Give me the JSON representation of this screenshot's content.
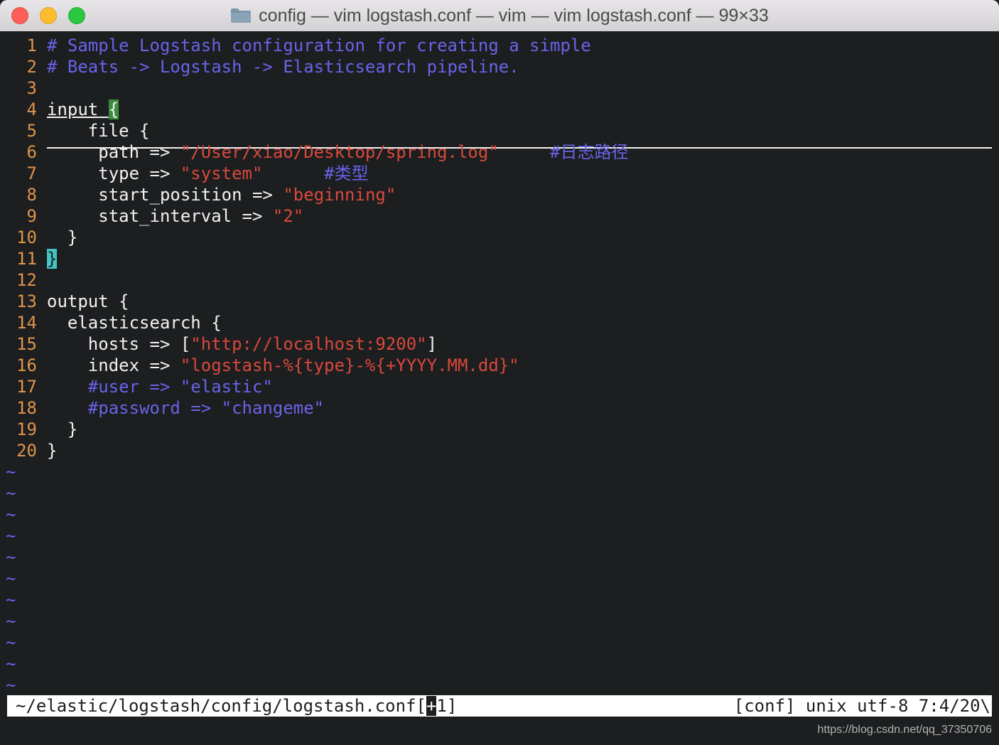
{
  "window": {
    "title": "config — vim logstash.conf — vim — vim logstash.conf — 99×33",
    "close_glyph": "×"
  },
  "colors": {
    "line_number": "#e0944a",
    "comment": "#6a63e8",
    "string": "#d9493c",
    "text": "#f2f2f2",
    "background": "#1c1e20"
  },
  "editor": {
    "lines": [
      {
        "num": "1",
        "comment": "# Sample Logstash configuration for creating a simple"
      },
      {
        "num": "2",
        "comment": "# Beats -> Logstash -> Elasticsearch pipeline."
      },
      {
        "num": "3"
      },
      {
        "num": "4",
        "text": "input",
        "sp": " ",
        "brace": "{"
      },
      {
        "num": "5",
        "text": "    file {"
      },
      {
        "num": "6",
        "text": "     path => ",
        "str": "\"/User/xiao/Desktop/spring.log\"",
        "gap": "     ",
        "comment": "#日志路径"
      },
      {
        "num": "7",
        "text": "     type => ",
        "str": "\"system\"",
        "gap": "      ",
        "comment": "#类型"
      },
      {
        "num": "8",
        "text": "     start_position => ",
        "str": "\"beginning\""
      },
      {
        "num": "9",
        "text": "     stat_interval => ",
        "str": "\"2\""
      },
      {
        "num": "10",
        "text": "  }"
      },
      {
        "num": "11",
        "brace": "}"
      },
      {
        "num": "12"
      },
      {
        "num": "13",
        "text": "output {"
      },
      {
        "num": "14",
        "text": "  elasticsearch {"
      },
      {
        "num": "15",
        "text": "    hosts => [",
        "str": "\"http://localhost:9200\"",
        "after": "]"
      },
      {
        "num": "16",
        "text": "    index => ",
        "str": "\"logstash-%{type}-%{+YYYY.MM.dd}\""
      },
      {
        "num": "17",
        "indent": "    ",
        "comment": "#user => \"elastic\""
      },
      {
        "num": "18",
        "indent": "    ",
        "comment": "#password => \"changeme\""
      },
      {
        "num": "19",
        "text": "  }"
      },
      {
        "num": "20",
        "text": "}"
      }
    ],
    "tilde": "~"
  },
  "statusbar": {
    "path": "~/elastic/logstash/config/logstash.conf[",
    "caret": "+",
    "path_end": "1]",
    "right": "[conf] unix utf-8 7:4/20\\"
  },
  "watermark": "https://blog.csdn.net/qq_37350706"
}
